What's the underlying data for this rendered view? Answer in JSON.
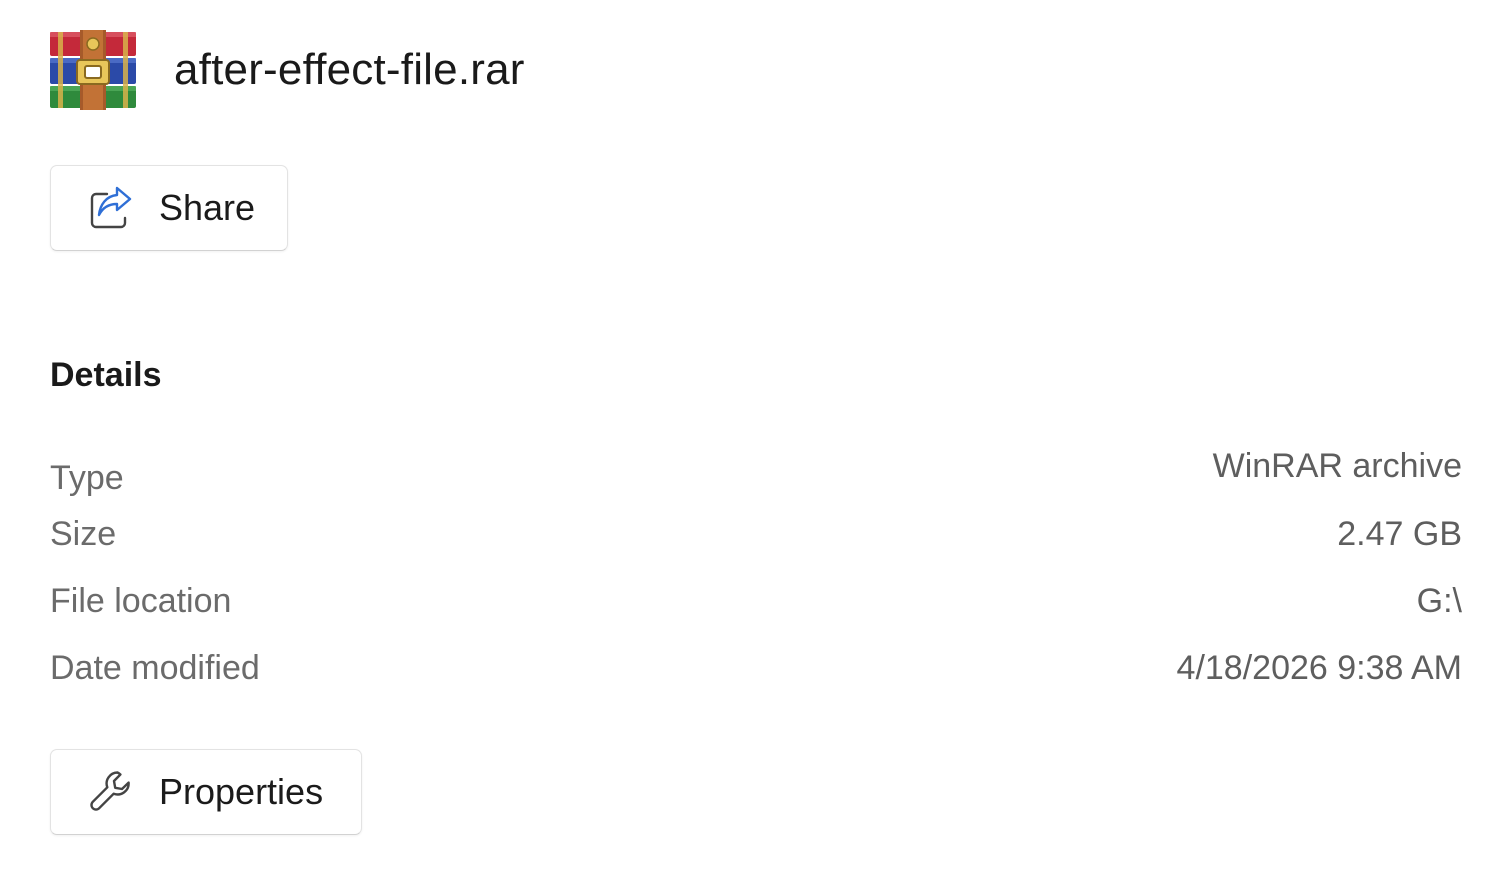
{
  "file": {
    "name": "after-effect-file.rar",
    "icon": "winrar-archive-icon"
  },
  "actions": {
    "share_label": "Share",
    "properties_label": "Properties"
  },
  "details": {
    "heading": "Details",
    "rows": [
      {
        "label": "Type",
        "value": "WinRAR archive"
      },
      {
        "label": "Size",
        "value": "2.47 GB"
      },
      {
        "label": "File location",
        "value": "G:\\"
      },
      {
        "label": "Date modified",
        "value": "4/18/2026 9:38 AM"
      }
    ]
  },
  "colors": {
    "accent": "#3a7bd5",
    "text_primary": "#1b1b1b",
    "text_secondary": "#6b6b6b",
    "border": "#e3e3e3"
  }
}
